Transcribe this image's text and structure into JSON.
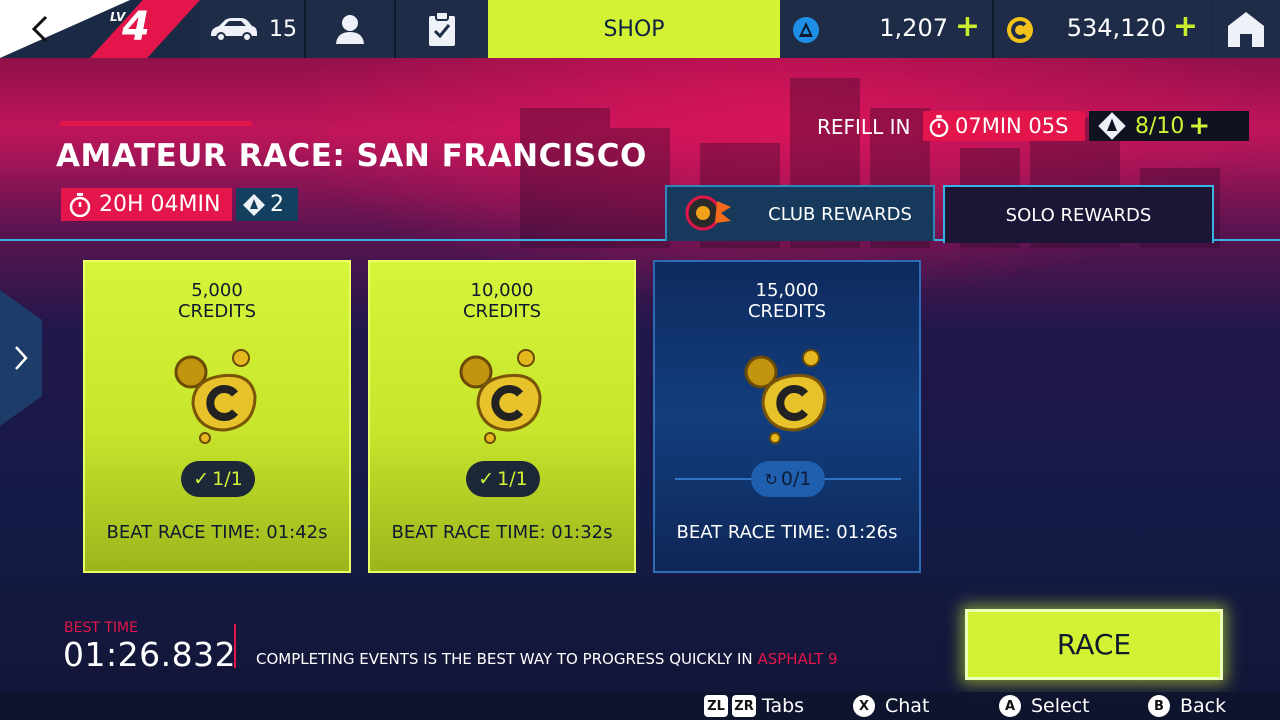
{
  "topbar": {
    "level_prefix": "LV",
    "level": "4",
    "cars_count": "15",
    "shop_label": "SHOP",
    "tokens": "1,207",
    "credits": "534,120",
    "plus": "+"
  },
  "event": {
    "title": "AMATEUR RACE: SAN FRANCISCO",
    "time_left": "20H 04MIN",
    "ticket_cost": "2"
  },
  "refill": {
    "label": "REFILL IN",
    "time": "07MIN 05S",
    "fuel": "8/10",
    "plus": "+"
  },
  "tabs": [
    {
      "label": "CLUB REWARDS"
    },
    {
      "label": "SOLO REWARDS"
    }
  ],
  "rewards": [
    {
      "amount": "5,000",
      "currency": "CREDITS",
      "progress": "1/1",
      "goal": "BEAT RACE TIME: 01:42s",
      "complete": true
    },
    {
      "amount": "10,000",
      "currency": "CREDITS",
      "progress": "1/1",
      "goal": "BEAT RACE TIME: 01:32s",
      "complete": true
    },
    {
      "amount": "15,000",
      "currency": "CREDITS",
      "progress": "0/1",
      "goal": "BEAT RACE TIME: 01:26s",
      "complete": false
    }
  ],
  "best": {
    "label": "BEST TIME",
    "time": "01:26.832"
  },
  "tip": {
    "text": "COMPLETING EVENTS IS THE BEST WAY TO PROGRESS QUICKLY IN ",
    "highlight": "ASPHALT 9"
  },
  "race_label": "RACE",
  "controls": [
    {
      "keys": [
        "ZL",
        "ZR"
      ],
      "label": "Tabs"
    },
    {
      "keys": [
        "X"
      ],
      "label": "Chat"
    },
    {
      "keys": [
        "A"
      ],
      "label": "Select"
    },
    {
      "keys": [
        "B"
      ],
      "label": "Back"
    }
  ],
  "colors": {
    "accent_lime": "#d2f233",
    "accent_red": "#e4154a",
    "panel_blue": "#1e2c47"
  }
}
